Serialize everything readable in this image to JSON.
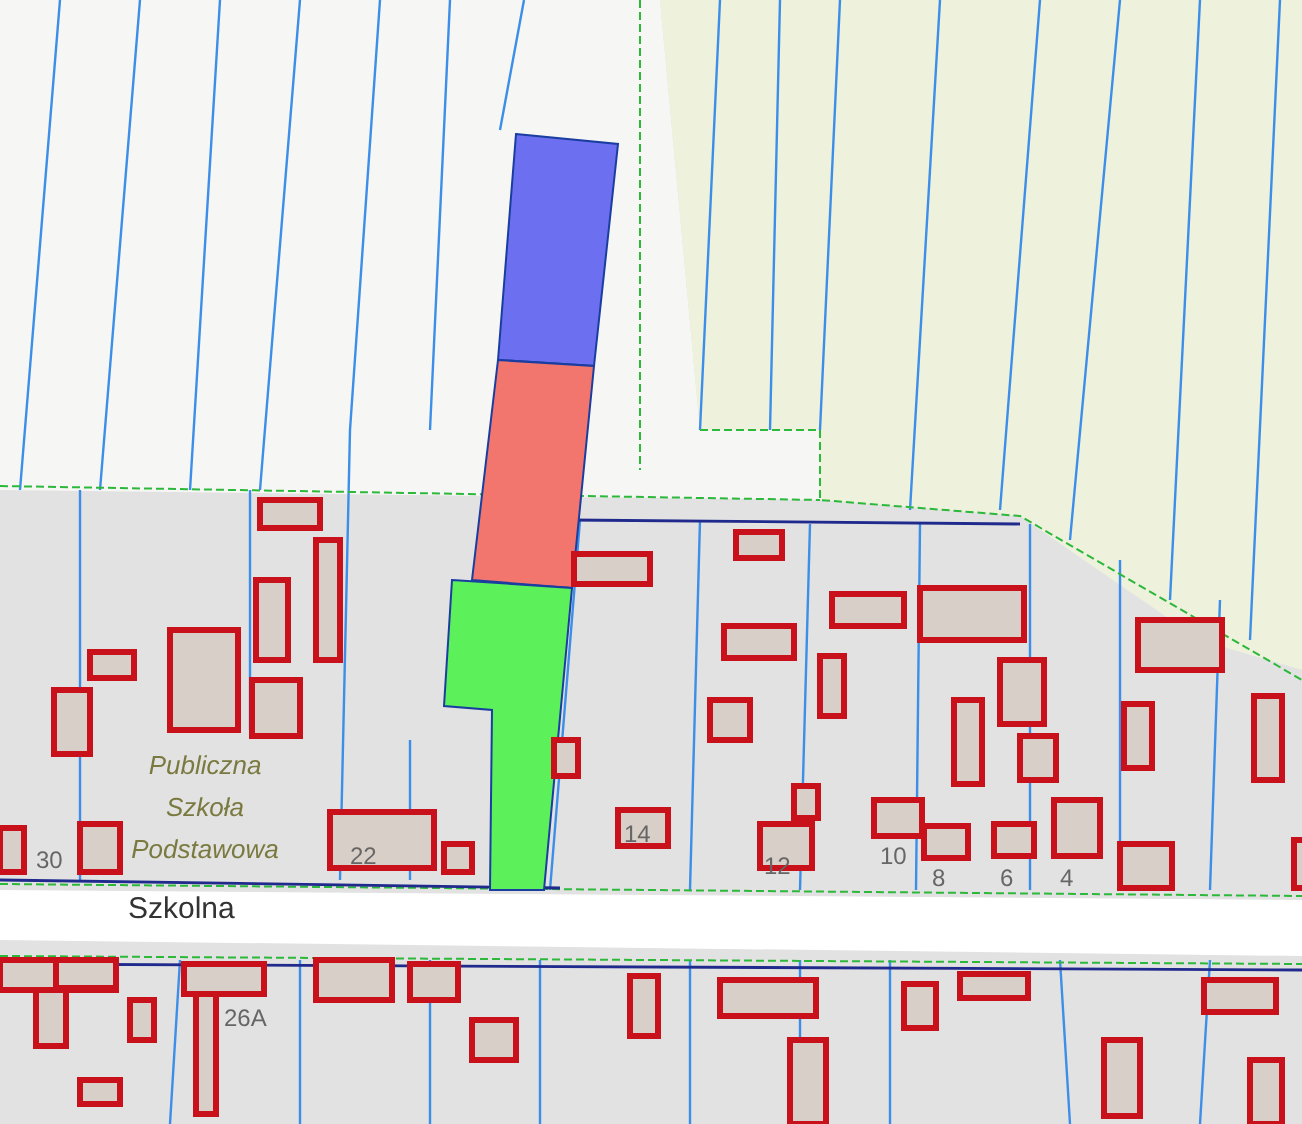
{
  "map": {
    "street_label": "Szkolna",
    "poi_label": "Publiczna Szkoła Podstawowa",
    "house_numbers": [
      "30",
      "22",
      "14",
      "12",
      "10",
      "8",
      "6",
      "4",
      "26A"
    ],
    "highlighted_plots": [
      {
        "color": "#6b6ff0"
      },
      {
        "color": "#f2766e"
      },
      {
        "color": "#5cf05a"
      }
    ]
  }
}
